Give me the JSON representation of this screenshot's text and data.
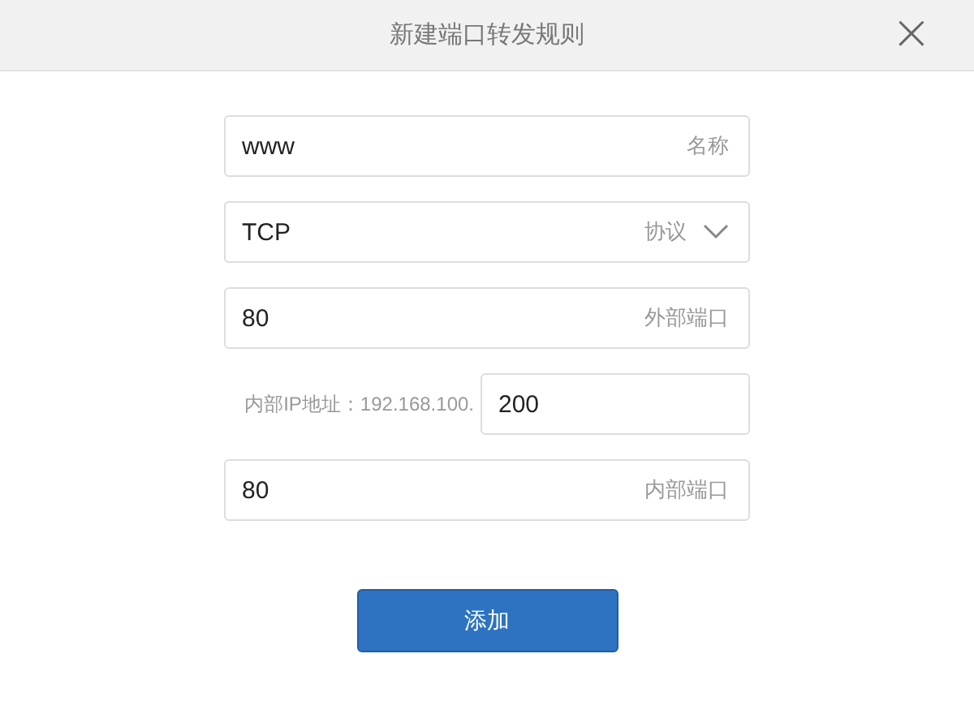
{
  "dialog": {
    "title": "新建端口转发规则",
    "close": "×"
  },
  "fields": [
    {
      "kind": "text",
      "value": "www",
      "label": "名称"
    },
    {
      "kind": "select",
      "value": "TCP",
      "label": "协议"
    },
    {
      "kind": "text",
      "value": "80",
      "label": "外部端口"
    },
    {
      "kind": "prefixed",
      "prefix": "内部IP地址：192.168.100.",
      "value": "200"
    },
    {
      "kind": "text",
      "value": "80",
      "label": "内部端口"
    }
  ],
  "submit": {
    "label": "添加"
  }
}
